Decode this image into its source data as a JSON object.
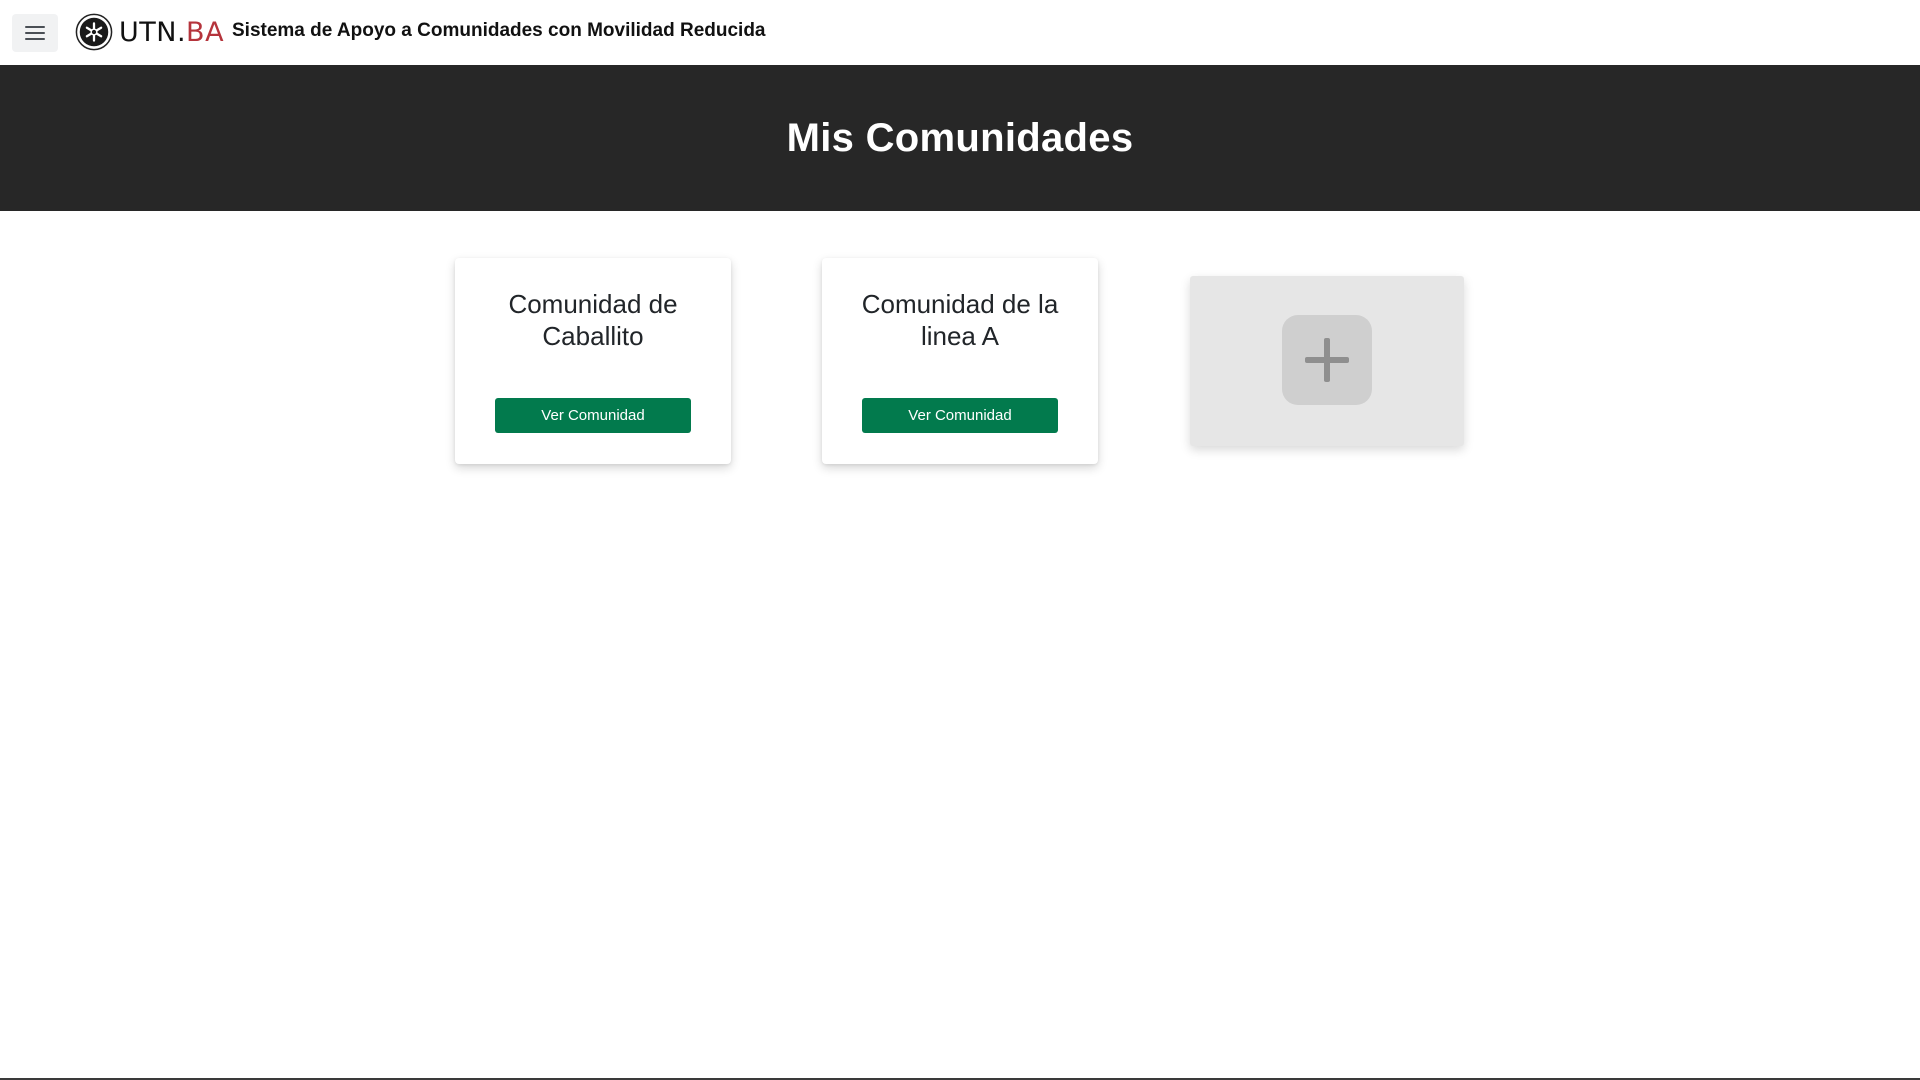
{
  "navbar": {
    "menu_icon": "hamburger-menu-icon",
    "logo_icon": "utn-seal-icon",
    "logo_text_main": "UTN.",
    "logo_text_accent": "BA",
    "app_title": "Sistema de Apoyo a Comunidades con Movilidad Reducida"
  },
  "hero": {
    "title": "Mis Comunidades"
  },
  "communities": [
    {
      "name": "Comunidad de Caballito",
      "button_label": "Ver Comunidad"
    },
    {
      "name": "Comunidad de la linea A",
      "button_label": "Ver Comunidad"
    }
  ],
  "add_card": {
    "icon": "plus-icon"
  },
  "colors": {
    "hero_bg": "#272727",
    "button_green": "#027a4d",
    "brand_red": "#b5343c",
    "add_card_bg": "#e6e6e6"
  }
}
